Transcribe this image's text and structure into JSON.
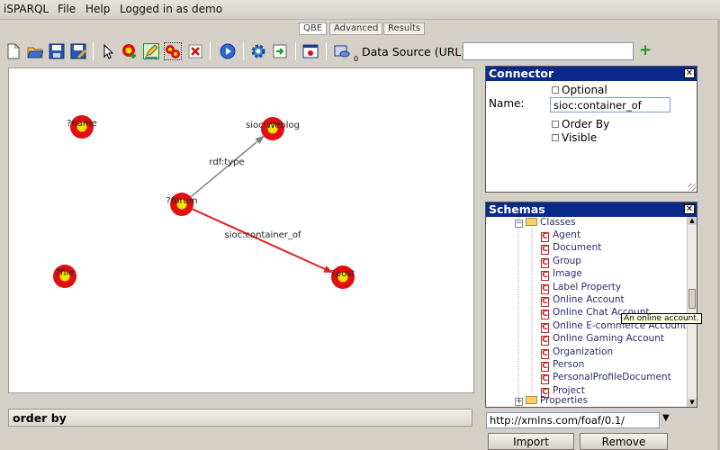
{
  "menu": {
    "app": "iSPARQL",
    "file": "File",
    "help": "Help",
    "login": "Logged in as demo"
  },
  "tabs": [
    "QBE",
    "Advanced",
    "Results"
  ],
  "toolbar": {
    "data_source_label": "Data Source (URL):",
    "data_source_value": "",
    "counter": "0",
    "add_symbol": "+"
  },
  "graph": {
    "nodes": [
      {
        "id": "n1",
        "label": "?name"
      },
      {
        "id": "n2",
        "label": "sioc:Weblog"
      },
      {
        "id": "n3",
        "label": "?forum"
      },
      {
        "id": "n4",
        "label": "?file"
      },
      {
        "id": "n5",
        "label": "?post"
      }
    ],
    "edges": [
      {
        "from": "n3",
        "to": "n2",
        "label": "rdf:type",
        "color": "#808080"
      },
      {
        "from": "n3",
        "to": "n5",
        "label": "sioc:container_of",
        "color": "#e02020"
      }
    ]
  },
  "order_by": "order by",
  "connector": {
    "title": "Connector",
    "optional": "Optional",
    "name_label": "Name:",
    "name_value": "sioc:container_of",
    "order_by": "Order By",
    "visible": "Visible"
  },
  "schemas": {
    "title": "Schemas",
    "classes_label": "Classes",
    "classes": [
      "Agent",
      "Document",
      "Group",
      "Image",
      "Label Property",
      "Online Account",
      "Online Chat Account",
      "Online E-commerce Account",
      "Online Gaming Account",
      "Organization",
      "Person",
      "PersonalProfileDocument",
      "Project"
    ],
    "properties_label": "Properties",
    "tooltip": "An online account.",
    "url": "http://xmlns.com/foaf/0.1/",
    "import": "Import",
    "remove": "Remove"
  },
  "colors": {
    "panel_header": "#0a2a8a",
    "node_outer": "#e01010",
    "node_inner": "#f5e400",
    "edge_selected": "#e02020",
    "edge_default": "#808080"
  }
}
